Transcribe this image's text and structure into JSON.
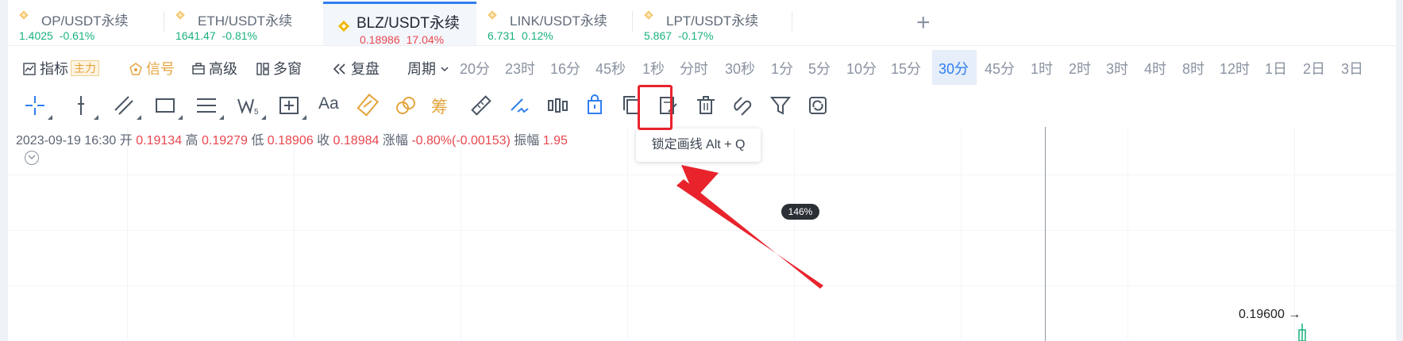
{
  "tabs": [
    {
      "name": "OP/USDT永续",
      "price": "1.4025",
      "change": "-0.61%"
    },
    {
      "name": "ETH/USDT永续",
      "price": "1641.47",
      "change": "-0.81%"
    },
    {
      "name": "BLZ/USDT永续",
      "price": "0.18986",
      "change": "17.04%"
    },
    {
      "name": "LINK/USDT永续",
      "price": "6.731",
      "change": "0.12%"
    },
    {
      "name": "LPT/USDT永续",
      "price": "5.867",
      "change": "-0.17%"
    }
  ],
  "active_tab_index": 2,
  "add_tab_symbol": "+",
  "row2": {
    "indicator": "指标",
    "indicator_badge": "主力",
    "signal": "信号",
    "advanced": "高级",
    "multiwindow": "多窗",
    "replay": "复盘",
    "period": "周期",
    "intervals": [
      "20分",
      "23时",
      "16分",
      "45秒",
      "1秒",
      "分时",
      "30秒",
      "1分",
      "5分",
      "10分",
      "15分",
      "30分",
      "45分",
      "1时",
      "2时",
      "3时",
      "4时",
      "8时",
      "12时",
      "1日",
      "2日",
      "3日"
    ],
    "selected_interval": "30分"
  },
  "toolbar": {
    "text_tool_label": "Aa",
    "chip_tool_label": "筹",
    "icons": [
      "crosshair-icon",
      "vertical-line-icon",
      "trend-line-icon",
      "rectangle-icon",
      "parallel-lines-icon",
      "wave-icon",
      "measure-box-icon",
      "text-icon",
      "fib-icon",
      "pattern-icon",
      "chip-icon",
      "ruler-icon",
      "brush-icon",
      "indicator-bars-icon",
      "lock-drawing-icon",
      "copy-icon",
      "edit-icon",
      "delete-icon",
      "magnet-icon",
      "filter-icon",
      "sync-icon"
    ],
    "lock_tooltip": "锁定画线 Alt + Q"
  },
  "ohlc": {
    "datetime": "2023-09-19 16:30",
    "open_label": "开",
    "open": "0.19134",
    "high_label": "高",
    "high": "0.19279",
    "low_label": "低",
    "low": "0.18906",
    "close_label": "收",
    "close": "0.18984",
    "change_label": "涨幅",
    "change": "-0.80%(-0.00153)",
    "amplitude_label": "振幅",
    "amplitude": "1.95"
  },
  "chart": {
    "zoom": "146%",
    "price_marker": "0.19600 →"
  },
  "colors": {
    "up": "#19b27d",
    "down": "#e8474e",
    "accent": "#2f7ef0",
    "gold": "#e3a43c",
    "annotation": "#e8232c"
  }
}
